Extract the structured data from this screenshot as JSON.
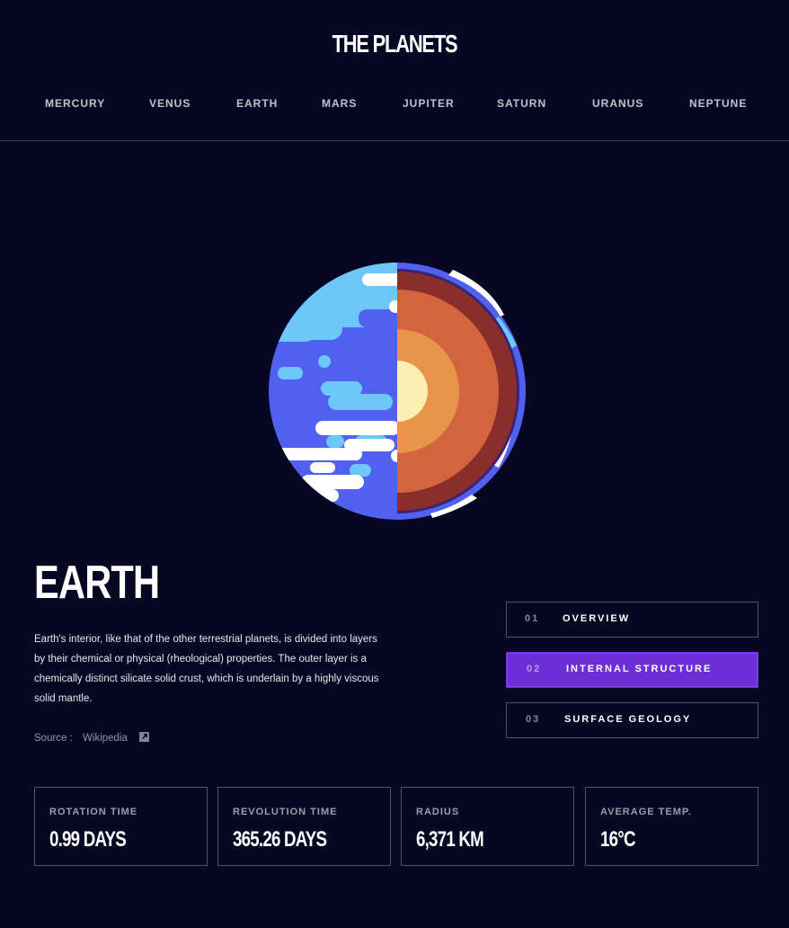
{
  "header": {
    "logo": "THE PLANETS",
    "nav": [
      "MERCURY",
      "VENUS",
      "EARTH",
      "MARS",
      "JUPITER",
      "SATURN",
      "URANUS",
      "NEPTUNE"
    ]
  },
  "planet": {
    "name": "EARTH",
    "description": "Earth's interior, like that of the other terrestrial planets, is divided into layers by their chemical or physical (rheological) properties. The outer layer is a chemically distinct silicate solid crust, which is underlain by a highly viscous solid mantle.",
    "source_label": "Source :",
    "source_link": "Wikipedia"
  },
  "tabs": [
    {
      "num": "01",
      "label": "OVERVIEW",
      "active": false
    },
    {
      "num": "02",
      "label": "INTERNAL STRUCTURE",
      "active": true
    },
    {
      "num": "03",
      "label": "SURFACE GEOLOGY",
      "active": false
    }
  ],
  "stats": [
    {
      "label": "ROTATION TIME",
      "value": "0.99 DAYS"
    },
    {
      "label": "REVOLUTION TIME",
      "value": "365.26 DAYS"
    },
    {
      "label": "RADIUS",
      "value": "6,371 KM"
    },
    {
      "label": "AVERAGE TEMP.",
      "value": "16°C"
    }
  ],
  "colors": {
    "background": "#070724",
    "accent": "#6D2ED5",
    "border": "#38384F",
    "ocean": "#5061F0",
    "land": "#6DC8F9",
    "crust": "#8A2E2C",
    "mantle": "#D2643E",
    "outer_core": "#E8944A",
    "inner_core": "#FDEFB1"
  }
}
